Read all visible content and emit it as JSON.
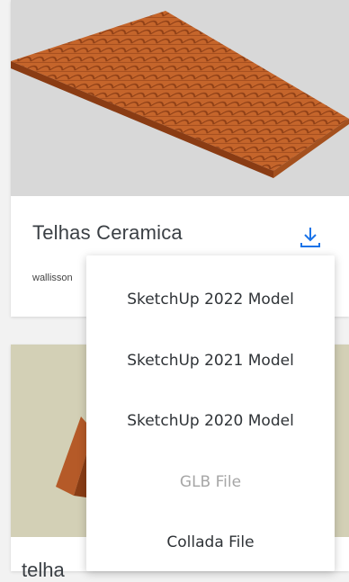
{
  "cards": [
    {
      "title": "Telhas Ceramica",
      "author": "wallisson"
    },
    {
      "title": "telha"
    }
  ],
  "download_icon": "download-icon",
  "accent_color": "#1a73e8",
  "menu": {
    "items": [
      {
        "label": "SketchUp 2022 Model",
        "enabled": true
      },
      {
        "label": "SketchUp 2021 Model",
        "enabled": true
      },
      {
        "label": "SketchUp 2020 Model",
        "enabled": true
      },
      {
        "label": "GLB File",
        "enabled": false
      },
      {
        "label": "Collada File",
        "enabled": true
      }
    ]
  }
}
